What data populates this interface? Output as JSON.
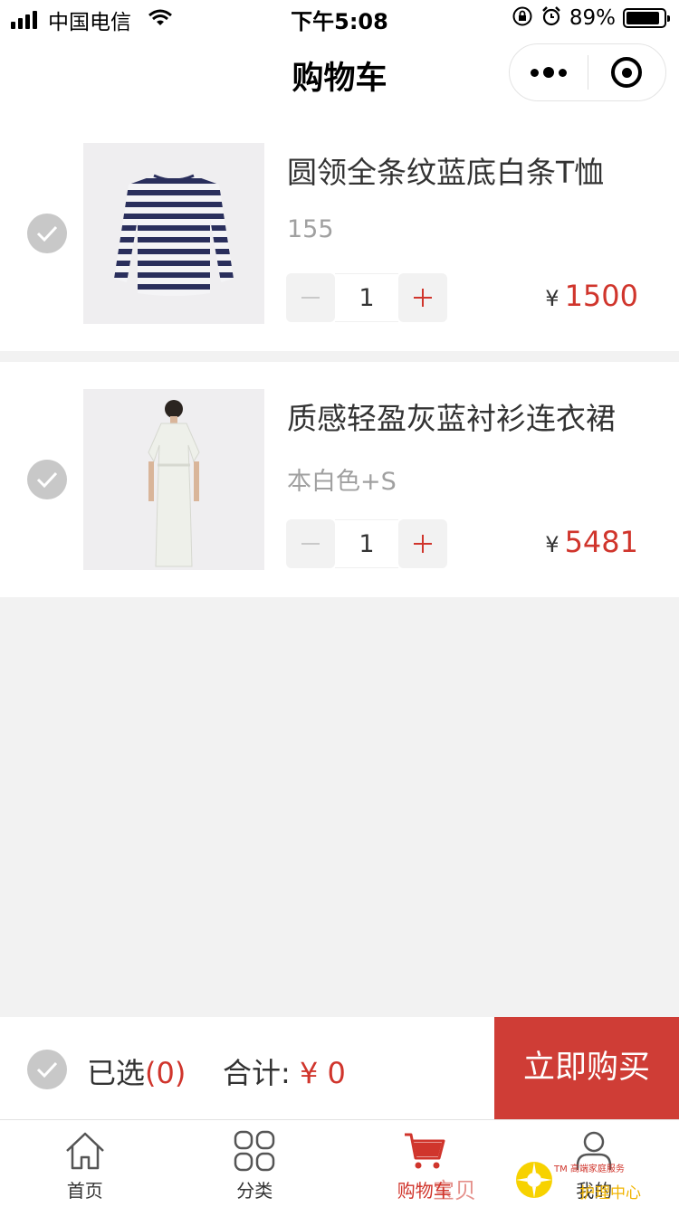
{
  "status_bar": {
    "carrier": "中国电信",
    "time": "下午5:08",
    "battery": "89%"
  },
  "nav": {
    "title": "购物车"
  },
  "cart": {
    "items": [
      {
        "name": "圆领全条纹蓝底白条T恤",
        "spec": "155",
        "quantity": "1",
        "currency": "¥",
        "price": "1500",
        "checked": false
      },
      {
        "name": "质感轻盈灰蓝衬衫连衣裙",
        "spec": "本白色+S",
        "quantity": "1",
        "currency": "¥",
        "price": "5481",
        "checked": false
      }
    ]
  },
  "checkout": {
    "selected_label": "已选",
    "selected_count": "(0)",
    "total_label": "合计:",
    "total_value": "¥ 0",
    "buy_label": "立即购买"
  },
  "tabbar": {
    "tabs": [
      {
        "label": "首页",
        "icon": "home-icon",
        "active": false
      },
      {
        "label": "分类",
        "icon": "category-icon",
        "active": false
      },
      {
        "label": "购物车",
        "icon": "cart-icon",
        "active": true
      },
      {
        "label": "我的",
        "icon": "user-icon",
        "active": false
      }
    ]
  },
  "watermark": {
    "text": "宝贝",
    "tm_text": "TM 高端家庭服务",
    "subtitle": "护理中心"
  },
  "colors": {
    "accent": "#d0352c",
    "buy_button": "#cf3d36",
    "check_gray": "#c8c8c8",
    "background": "#f2f2f2"
  }
}
